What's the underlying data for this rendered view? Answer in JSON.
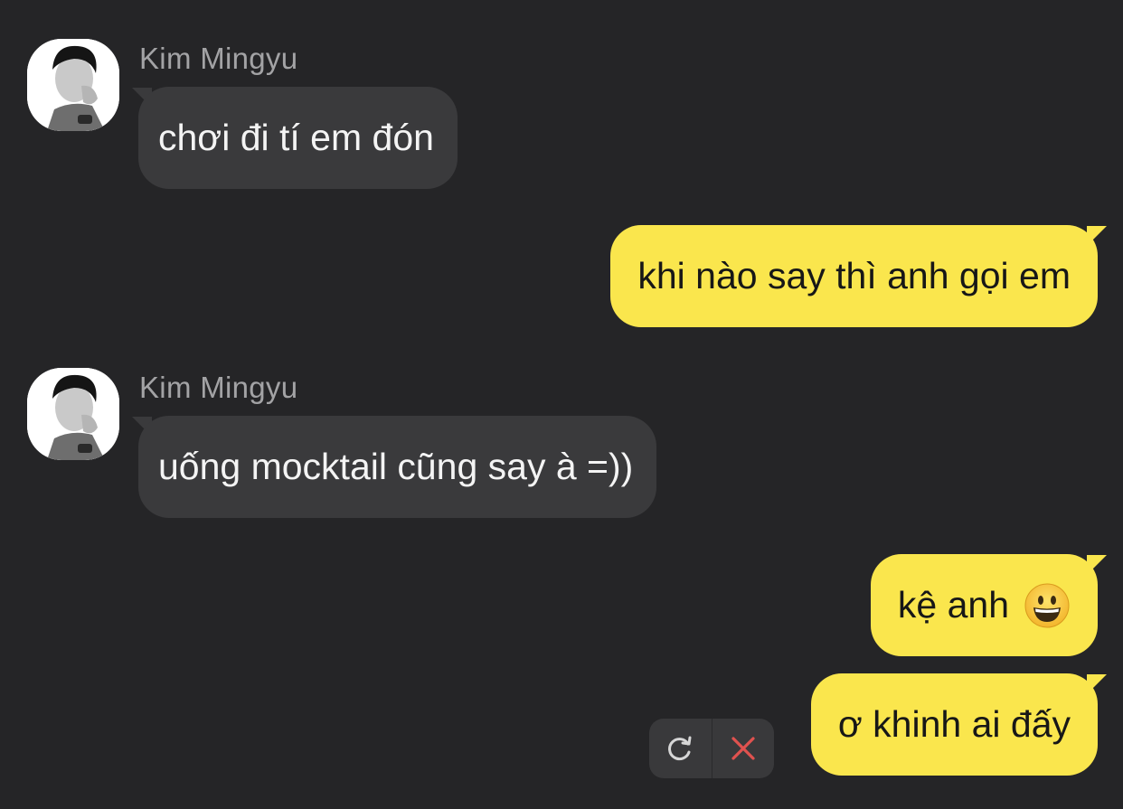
{
  "chat": {
    "messages": [
      {
        "direction": "incoming",
        "sender": "Kim Mingyu",
        "text": "chơi đi tí em đón"
      },
      {
        "direction": "outgoing",
        "text": "khi nào say thì anh gọi em"
      },
      {
        "direction": "incoming",
        "sender": "Kim Mingyu",
        "text": "uống mocktail cũng say à =))"
      },
      {
        "direction": "outgoing",
        "text": "kệ anh",
        "emoji": "grinning-face"
      },
      {
        "direction": "outgoing",
        "text": "ơ khinh ai đấy",
        "status": "failed"
      }
    ],
    "failed_actions": {
      "retry_icon": "retry-icon",
      "delete_icon": "close-icon"
    }
  },
  "colors": {
    "background": "#252527",
    "incoming_bubble": "#3a3a3c",
    "outgoing_bubble": "#fae64d",
    "sender_name": "#a3a3a5",
    "delete_red": "#e0524f"
  }
}
